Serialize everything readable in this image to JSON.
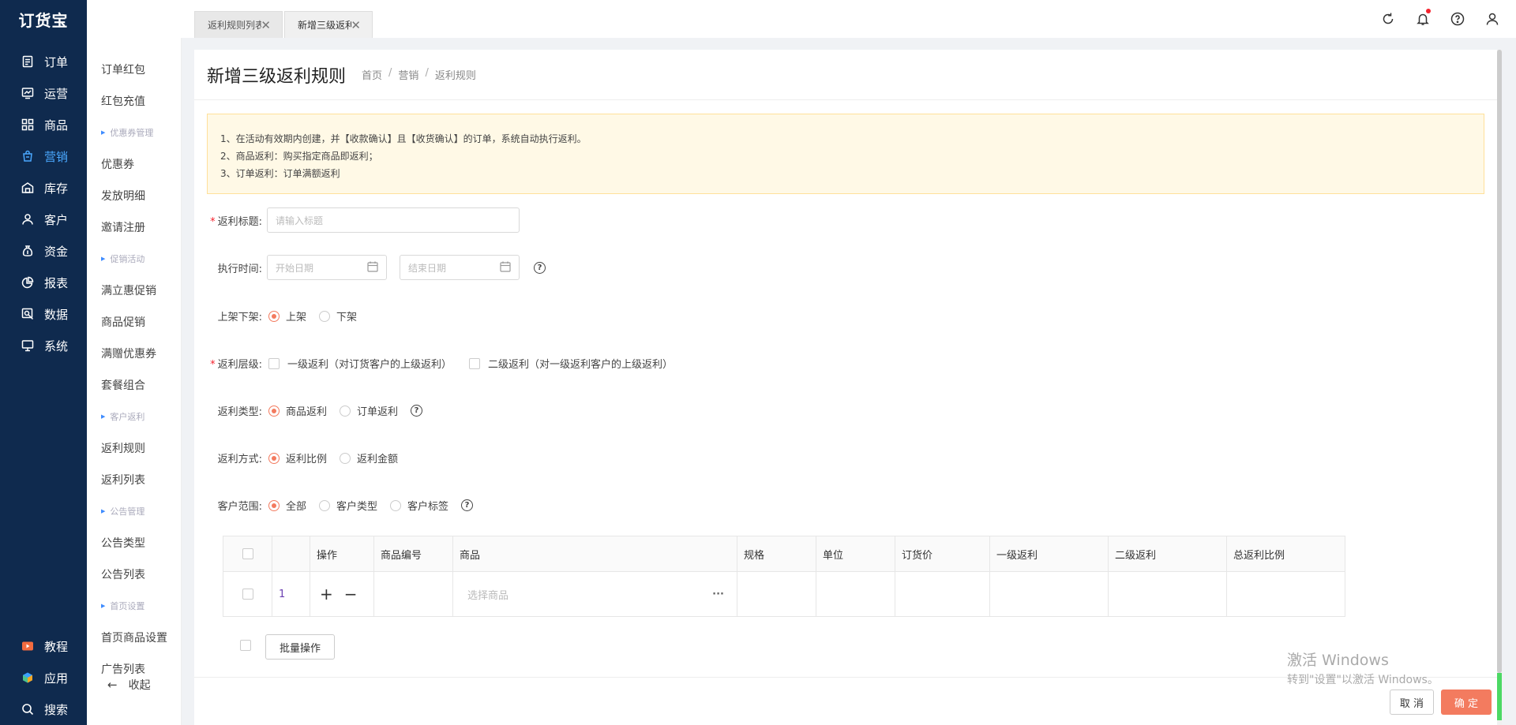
{
  "app": {
    "logo": "订货宝"
  },
  "nav": {
    "top": [
      {
        "label": "订单",
        "icon": "order-icon"
      },
      {
        "label": "运营",
        "icon": "operation-icon"
      },
      {
        "label": "商品",
        "icon": "goods-icon"
      },
      {
        "label": "营销",
        "icon": "marketing-icon",
        "active": true
      },
      {
        "label": "库存",
        "icon": "warehouse-icon"
      },
      {
        "label": "客户",
        "icon": "customer-icon"
      },
      {
        "label": "资金",
        "icon": "money-bag-icon"
      },
      {
        "label": "报表",
        "icon": "pie-chart-icon"
      },
      {
        "label": "数据",
        "icon": "data-icon"
      },
      {
        "label": "系统",
        "icon": "monitor-icon"
      }
    ],
    "bottom": [
      {
        "label": "教程",
        "icon": "play-icon"
      },
      {
        "label": "应用",
        "icon": "cube-icon"
      },
      {
        "label": "搜索",
        "icon": "search-icon"
      }
    ]
  },
  "submenu": {
    "items": [
      {
        "type": "item",
        "label": "订单红包"
      },
      {
        "type": "item",
        "label": "红包充值"
      },
      {
        "type": "group",
        "label": "优惠券管理"
      },
      {
        "type": "item",
        "label": "优惠券"
      },
      {
        "type": "item",
        "label": "发放明细"
      },
      {
        "type": "item",
        "label": "邀请注册"
      },
      {
        "type": "group",
        "label": "促销活动"
      },
      {
        "type": "item",
        "label": "满立惠促销"
      },
      {
        "type": "item",
        "label": "商品促销"
      },
      {
        "type": "item",
        "label": "满赠优惠券"
      },
      {
        "type": "item",
        "label": "套餐组合"
      },
      {
        "type": "group",
        "label": "客户返利"
      },
      {
        "type": "item",
        "label": "返利规则"
      },
      {
        "type": "item",
        "label": "返利列表"
      },
      {
        "type": "group",
        "label": "公告管理"
      },
      {
        "type": "item",
        "label": "公告类型"
      },
      {
        "type": "item",
        "label": "公告列表"
      },
      {
        "type": "group",
        "label": "首页设置"
      },
      {
        "type": "item",
        "label": "首页商品设置"
      },
      {
        "type": "item",
        "label": "广告列表"
      }
    ],
    "collapse_arrow": "←",
    "collapse": "收起"
  },
  "tabs": [
    {
      "label": "返利规则列表"
    },
    {
      "label": "新增三级返利规则",
      "active": true
    }
  ],
  "tab_close": "✕",
  "page": {
    "title": "新增三级返利规则",
    "breadcrumb": [
      "首页",
      "营销",
      "返利规则"
    ],
    "breadcrumb_sep": "/"
  },
  "notice": [
    "1、在活动有效期内创建，并【收款确认】且【收货确认】的订单，系统自动执行返利。",
    "2、商品返利：购买指定商品即返利；",
    "3、订单返利：订单满额返利"
  ],
  "form": {
    "required_mark": "*",
    "help_mark": "?",
    "title": {
      "label": "返利标题:",
      "placeholder": "请输入标题"
    },
    "time": {
      "label": "执行时间:",
      "start_placeholder": "开始日期",
      "end_placeholder": "结束日期"
    },
    "shelf": {
      "label": "上架下架:",
      "options": [
        "上架",
        "下架"
      ],
      "selected": 0
    },
    "level": {
      "label": "返利层级:",
      "options": [
        "一级返利（对订货客户的上级返利）",
        "二级返利（对一级返利客户的上级返利）"
      ]
    },
    "type": {
      "label": "返利类型:",
      "options": [
        "商品返利",
        "订单返利"
      ],
      "selected": 0
    },
    "method": {
      "label": "返利方式:",
      "options": [
        "返利比例",
        "返利金额"
      ],
      "selected": 0
    },
    "scope": {
      "label": "客户范围:",
      "options": [
        "全部",
        "客户类型",
        "客户标签"
      ],
      "selected": 0
    }
  },
  "table": {
    "columns": [
      "",
      "",
      "操作",
      "商品编号",
      "商品",
      "规格",
      "单位",
      "订货价",
      "一级返利",
      "二级返利",
      "总返利比例"
    ],
    "rows": [
      {
        "index": "1",
        "add": "+",
        "remove": "−",
        "product_placeholder": "选择商品",
        "more": "···"
      }
    ]
  },
  "actions": {
    "batch": "批量操作",
    "cancel": "取 消",
    "ok": "确 定"
  },
  "watermark": {
    "line1": "激活 Windows",
    "line2": "转到\"设置\"以激活 Windows。"
  },
  "colors": {
    "nav_bg": "#0f2a4e",
    "accent": "#f37b5f",
    "nav_active": "#4aa8ff",
    "notice_bg": "#fff9e6"
  }
}
